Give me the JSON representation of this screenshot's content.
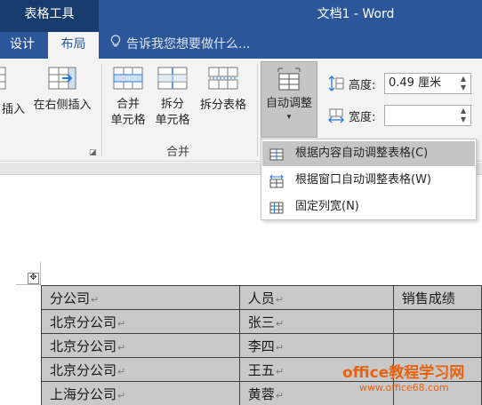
{
  "title_bar": {
    "context_tab_group": "表格工具",
    "document_title": "文档1 - Word",
    "colors": {
      "title_bar_bg": "#2b579a",
      "context_group_bg": "#183b6e"
    }
  },
  "tabs": {
    "design": "设计",
    "layout": "布局",
    "tell_me": "告诉我您想要做什么..."
  },
  "ribbon": {
    "insert_partial": "插入",
    "insert_right": "在右侧插入",
    "merge_cells_line1": "合并",
    "merge_cells_line2": "单元格",
    "split_cells_line1": "拆分",
    "split_cells_line2": "单元格",
    "split_table": "拆分表格",
    "merge_group_label": "合并",
    "autofit": "自动调整",
    "height_label": "高度:",
    "height_value": "0.49 厘米",
    "width_label": "宽度:",
    "width_value": ""
  },
  "autofit_menu": [
    {
      "label": "根据内容自动调整表格(C)",
      "icon": "autofit-contents-icon",
      "highlighted": true
    },
    {
      "label": "根据窗口自动调整表格(W)",
      "icon": "autofit-window-icon",
      "highlighted": false
    },
    {
      "label": "固定列宽(N)",
      "icon": "fixed-column-width-icon",
      "highlighted": false
    }
  ],
  "table": {
    "rows": [
      [
        "分公司",
        "人员",
        "销售成绩"
      ],
      [
        "北京分公司",
        "张三",
        ""
      ],
      [
        "北京分公司",
        "李四",
        ""
      ],
      [
        "北京分公司",
        "王五",
        ""
      ],
      [
        "上海分公司",
        "黄蓉",
        ""
      ]
    ],
    "paragraph_mark": "↵"
  },
  "watermark": {
    "line1": "office教程学习网",
    "line2": "www.office68.com"
  }
}
